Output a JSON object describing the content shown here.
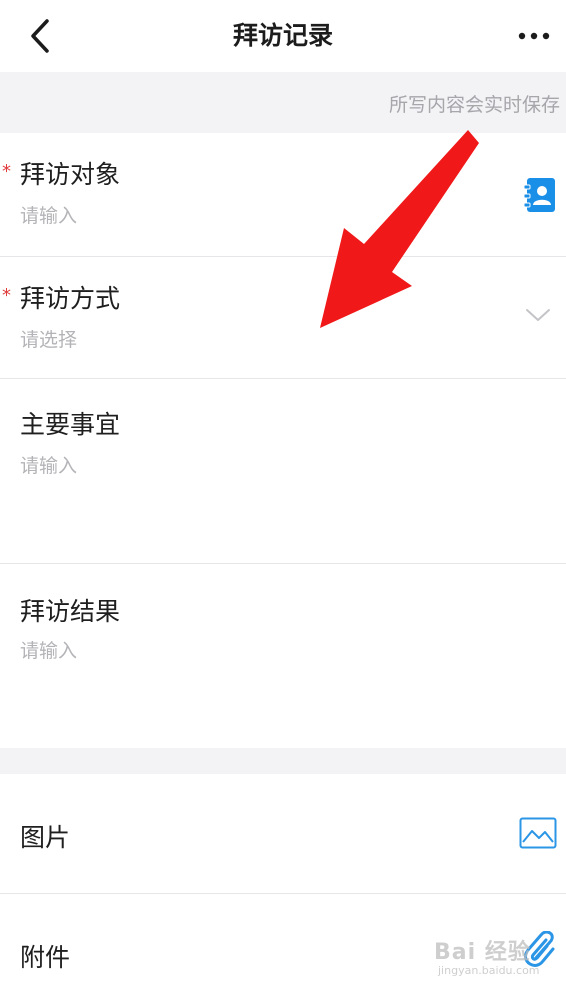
{
  "nav": {
    "title": "拜访记录"
  },
  "notice": "所写内容会实时保存",
  "fields": {
    "visit_target": {
      "label": "拜访对象",
      "placeholder": "请输入",
      "required_mark": "*"
    },
    "visit_method": {
      "label": "拜访方式",
      "placeholder": "请选择",
      "required_mark": "*"
    },
    "main_matters": {
      "label": "主要事宜",
      "placeholder": "请输入"
    },
    "visit_result": {
      "label": "拜访结果",
      "placeholder": "请输入"
    }
  },
  "attachments": {
    "image": {
      "label": "图片"
    },
    "file": {
      "label": "附件"
    }
  },
  "watermark": {
    "text": "Bai 经验",
    "sub": "jingyan.baidu.com"
  },
  "colors": {
    "accent": "#1a8fe8",
    "required": "#e03a3a",
    "annotation_arrow": "#f01818"
  }
}
